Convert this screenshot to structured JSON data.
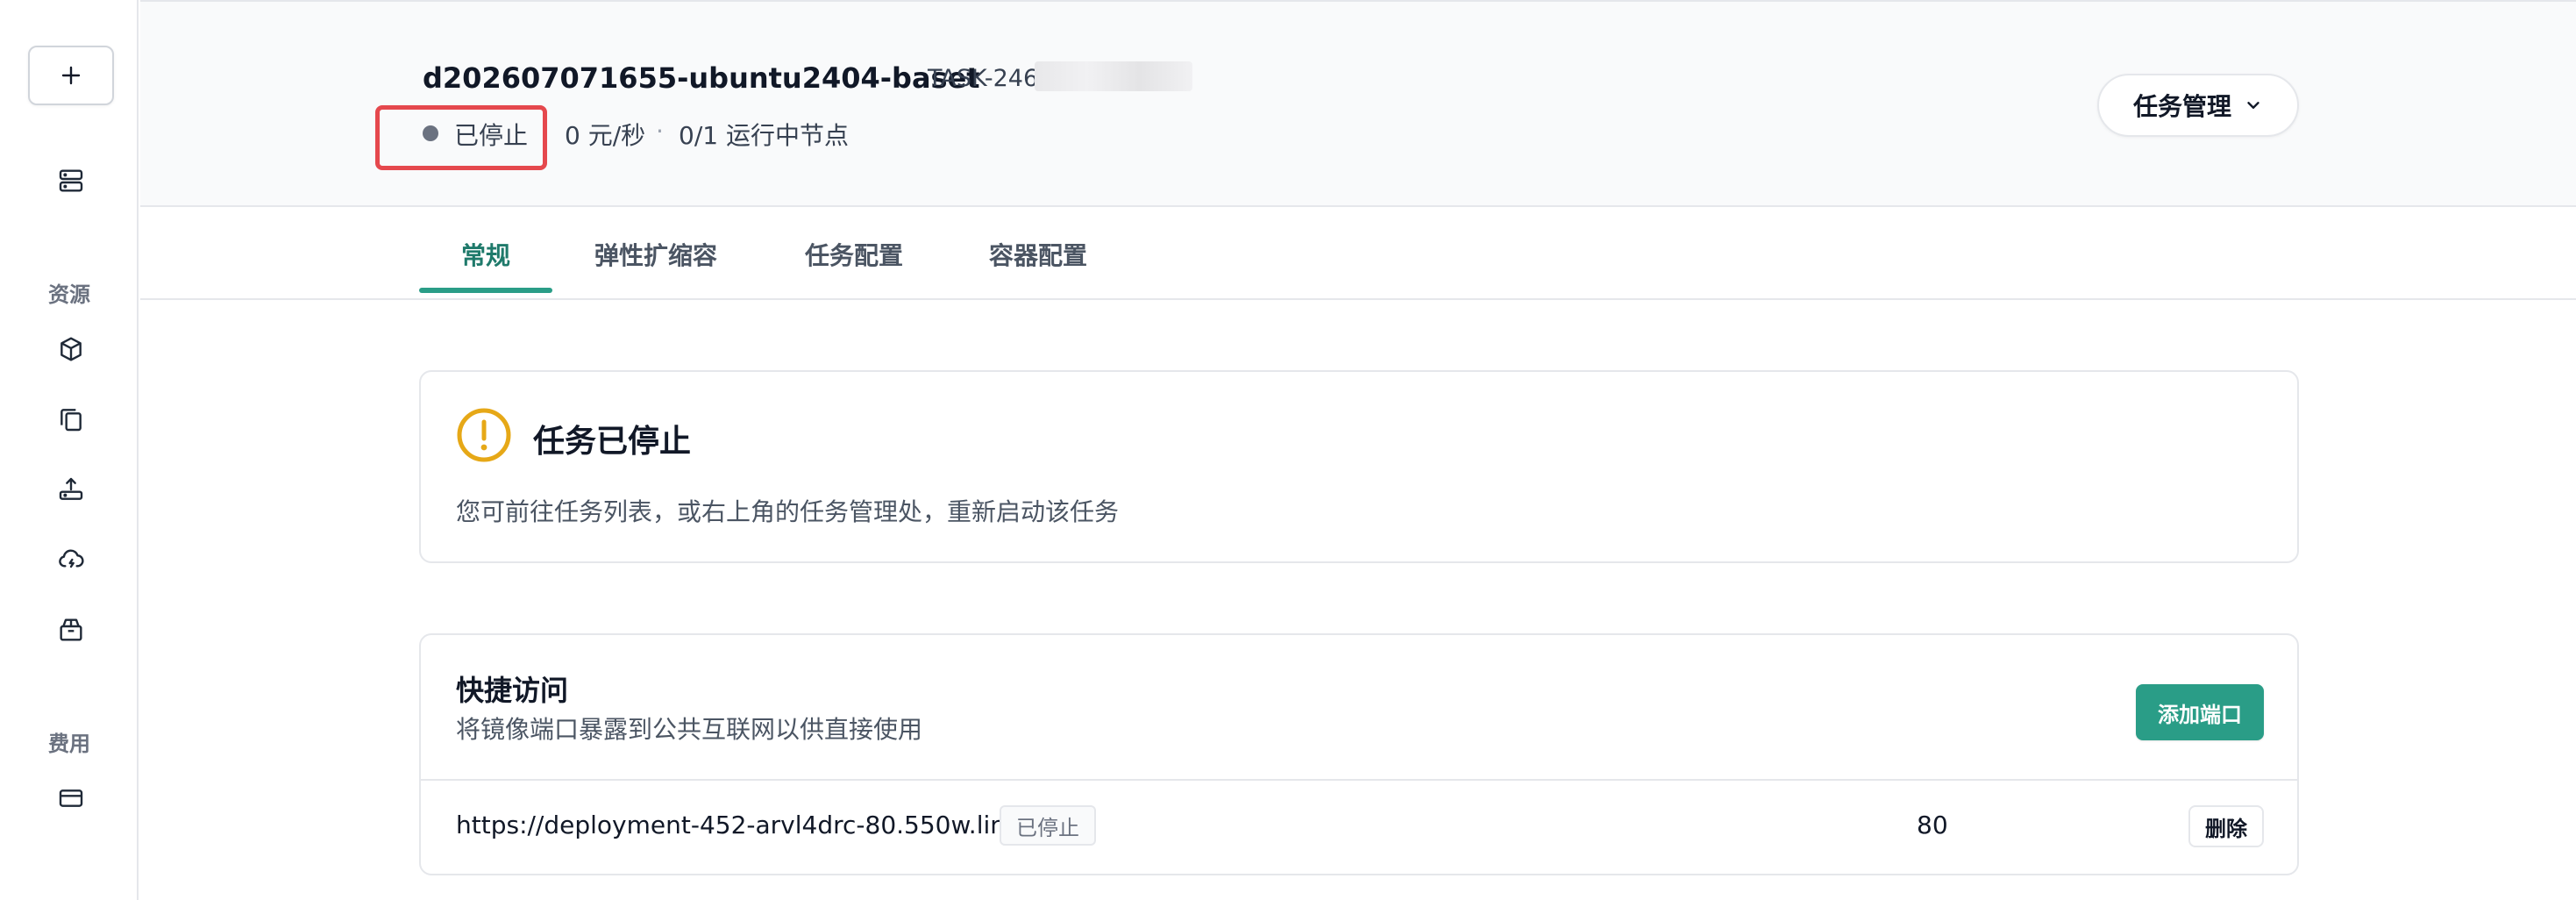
{
  "sidebar": {
    "add_label": "+",
    "sections": {
      "resources": "资源",
      "billing": "费用"
    },
    "icons": [
      "server-icon",
      "box-icon",
      "copy-icon",
      "upload-icon",
      "cloud-sync-icon",
      "package-icon",
      "credit-card-icon"
    ]
  },
  "header": {
    "title": "d202607071655-ubuntu2404-baset",
    "task_id": "TASK-246",
    "status": "已停止",
    "price": "0 元/秒",
    "separator": "·",
    "nodes": "0/1 运行中节点",
    "manage_label": "任务管理"
  },
  "tabs": [
    {
      "label": "常规",
      "active": true
    },
    {
      "label": "弹性扩缩容",
      "active": false
    },
    {
      "label": "任务配置",
      "active": false
    },
    {
      "label": "容器配置",
      "active": false
    }
  ],
  "alert": {
    "title": "任务已停止",
    "description": "您可前往任务列表，或右上角的任务管理处，重新启动该任务"
  },
  "quick_access": {
    "title": "快捷访问",
    "description": "将镜像端口暴露到公共互联网以供直接使用",
    "add_port_label": "添加端口",
    "rows": [
      {
        "url": "https://deployment-452-arvl4drc-80.550w.link",
        "status": "已停止",
        "port": "80",
        "delete_label": "删除"
      }
    ]
  },
  "colors": {
    "accent": "#2a9d87",
    "warning": "#e6a817",
    "highlight_border": "#e5484d",
    "status_dot": "#6b7280"
  }
}
